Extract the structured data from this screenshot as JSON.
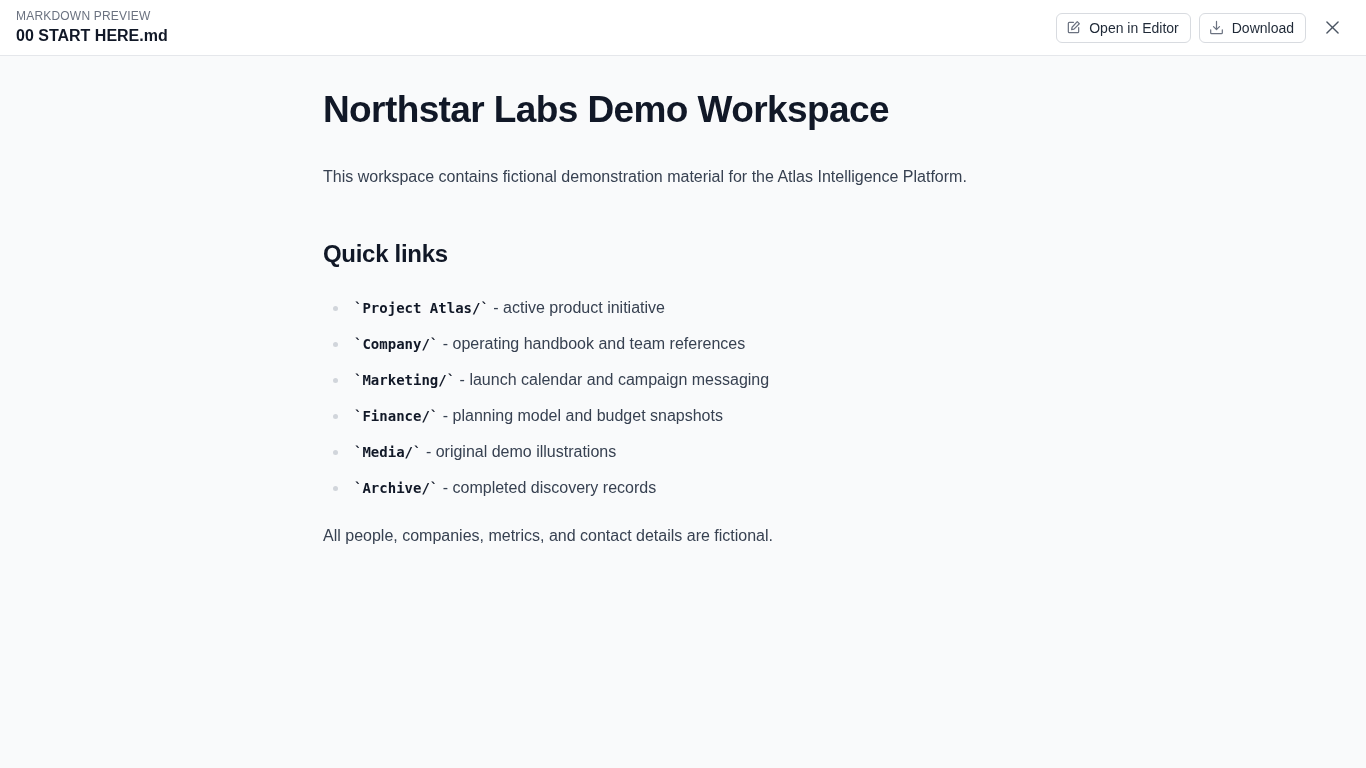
{
  "header": {
    "eyebrow": "MARKDOWN PREVIEW",
    "title": "00 START HERE.md",
    "buttons": [
      {
        "label": "Open in Editor",
        "kind": "edit"
      },
      {
        "label": "Download",
        "kind": "download"
      }
    ]
  },
  "document": {
    "title": "Northstar Labs Demo Workspace",
    "intro": "This workspace contains fictional demonstration material for the Atlas Intelligence Platform.",
    "sections": [
      {
        "heading": "Quick links",
        "items": [
          {
            "code": "`Project Atlas/`",
            "text": "- active product initiative"
          },
          {
            "code": "`Company/`",
            "text": "- operating handbook and team references"
          },
          {
            "code": "`Marketing/`",
            "text": "- launch calendar and campaign messaging"
          },
          {
            "code": "`Finance/`",
            "text": "- planning model and budget snapshots"
          },
          {
            "code": "`Media/`",
            "text": "- original demo illustrations"
          },
          {
            "code": "`Archive/`",
            "text": "- completed discovery records"
          }
        ]
      }
    ],
    "note": "All people, companies, metrics, and contact details are fictional."
  }
}
